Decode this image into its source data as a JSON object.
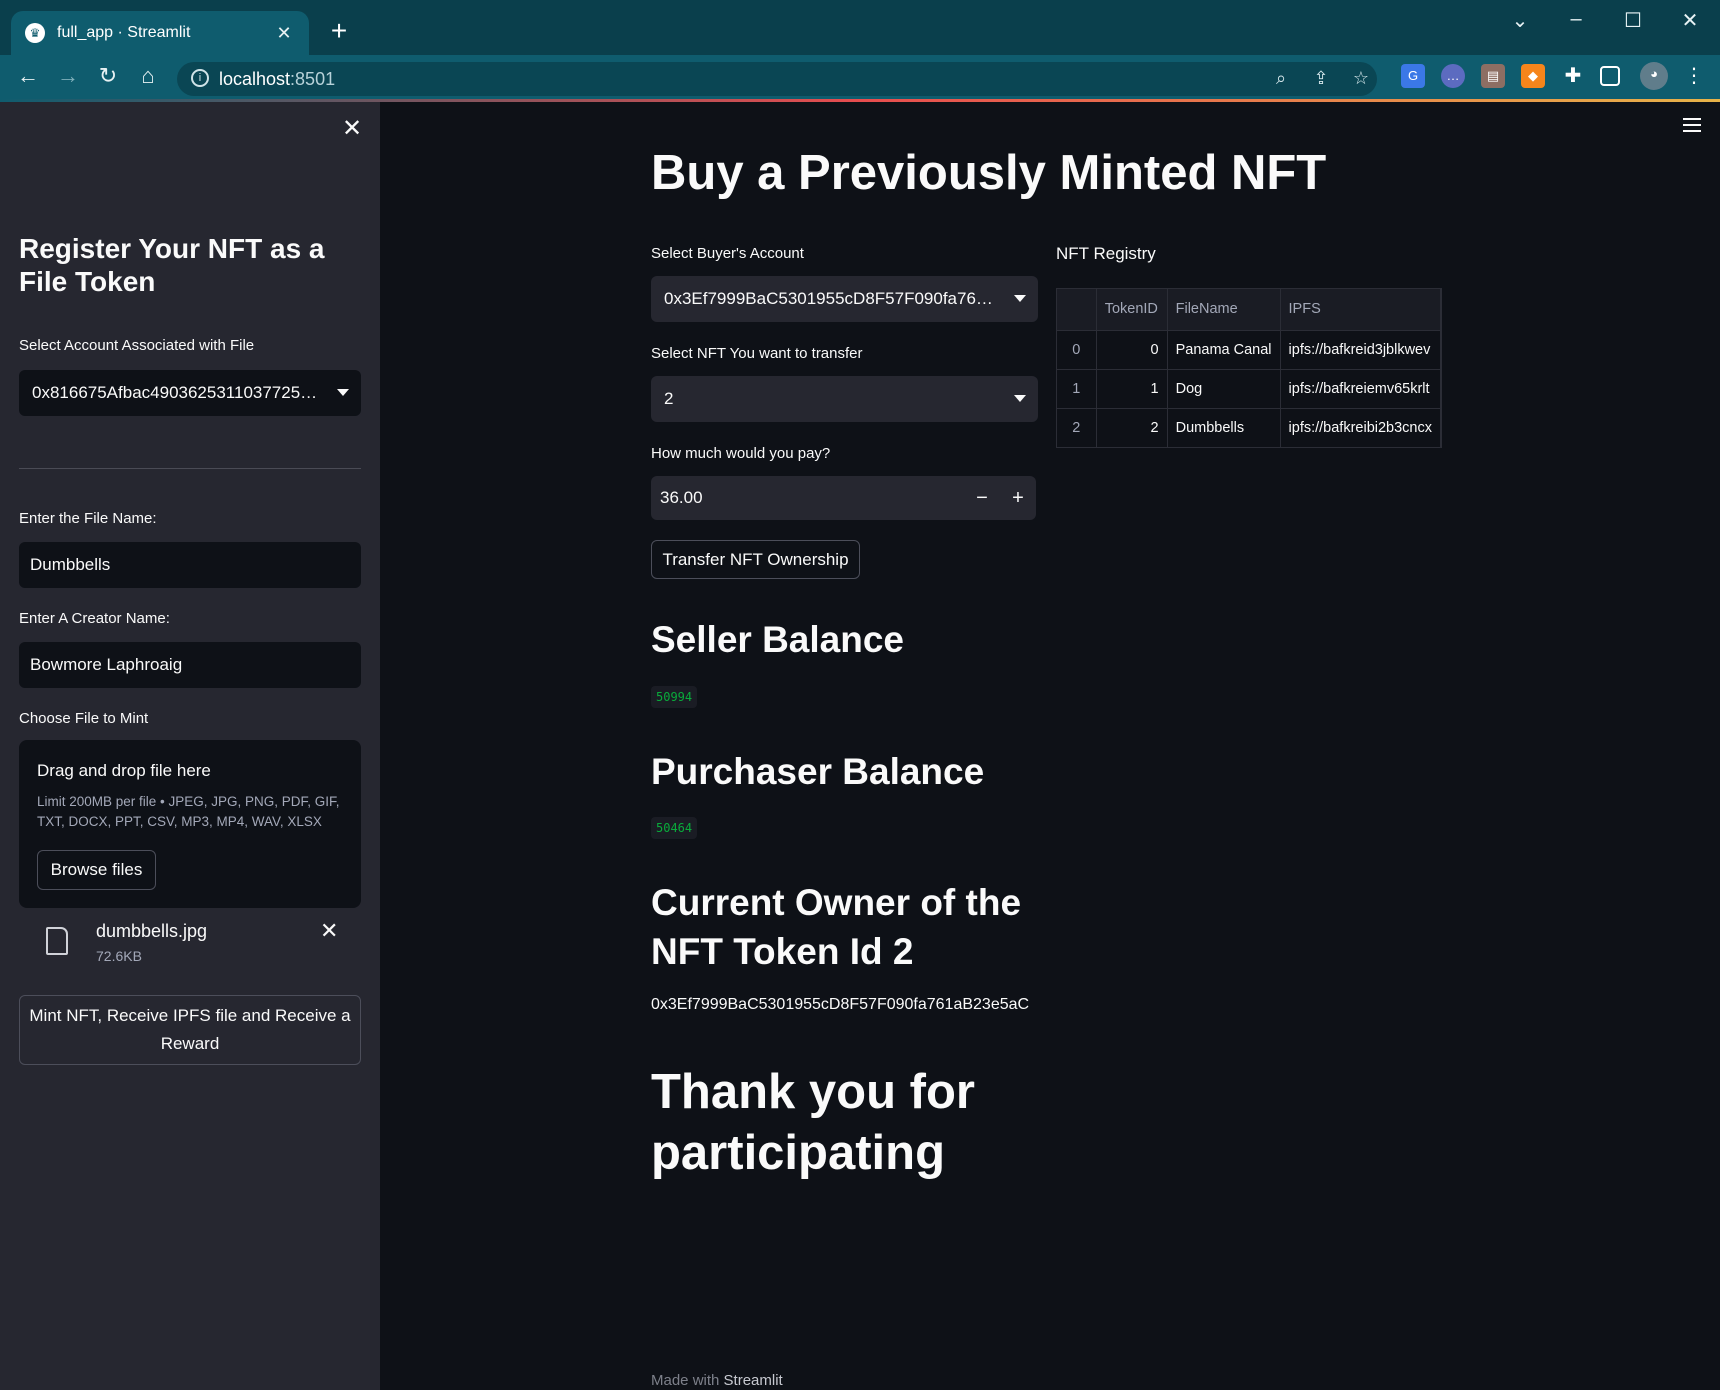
{
  "browser": {
    "tab_title": "full_app · Streamlit",
    "url_host": "localhost",
    "url_port": ":8501"
  },
  "sidebar": {
    "title": "Register Your NFT as a File Token",
    "account_label": "Select Account Associated with File",
    "account_value": "0x816675Afbac49036253110377255…",
    "file_name_label": "Enter the File Name:",
    "file_name_value": "Dumbbells",
    "creator_label": "Enter A Creator Name:",
    "creator_value": "Bowmore Laphroaig",
    "choose_file_label": "Choose File to Mint",
    "dropzone_title": "Drag and drop file here",
    "dropzone_limit": "Limit 200MB per file • JPEG, JPG, PNG, PDF, GIF, TXT, DOCX, PPT, CSV, MP3, MP4, WAV, XLSX",
    "browse_label": "Browse files",
    "uploaded_file_name": "dumbbells.jpg",
    "uploaded_file_size": "72.6KB",
    "mint_button_label": "Mint NFT, Receive IPFS file and Receive a Reward"
  },
  "main": {
    "title": "Buy a Previously Minted NFT",
    "buyer_label": "Select Buyer's Account",
    "buyer_value": "0x3Ef7999BaC5301955cD8F57F090fa761a…",
    "nft_label": "Select NFT You want to transfer",
    "nft_value": "2",
    "pay_label": "How much would you pay?",
    "pay_value": "36.00",
    "transfer_button_label": "Transfer NFT Ownership",
    "seller_heading": "Seller Balance",
    "seller_balance": "50994",
    "purchaser_heading": "Purchaser Balance",
    "purchaser_balance": "50464",
    "owner_heading": "Current Owner of the NFT Token Id 2",
    "owner_address": "0x3Ef7999BaC5301955cD8F57F090fa761aB23e5aC",
    "thanks_heading": "Thank you for participating",
    "footer_prefix": "Made with ",
    "footer_brand": "Streamlit"
  },
  "registry": {
    "title": "NFT Registry",
    "columns": [
      "",
      "TokenID",
      "FileName",
      "IPFS"
    ],
    "rows": [
      [
        "0",
        "0",
        "Panama Canal",
        "ipfs://bafkreid3jblkwev"
      ],
      [
        "1",
        "1",
        "Dog",
        "ipfs://bafkreiemv65krlt"
      ],
      [
        "2",
        "2",
        "Dumbbells",
        "ipfs://bafkreibi2b3cncx"
      ]
    ]
  },
  "colors": {
    "app_background": "#0e1117",
    "sidebar_background": "#262730",
    "browser_frame": "#0f5c6e",
    "code_green": "#09ab3b"
  },
  "icons": [
    "streamlit-favicon",
    "close-icon",
    "plus-icon",
    "back-icon",
    "forward-icon",
    "reload-icon",
    "home-icon",
    "info-icon",
    "zoom-icon",
    "share-icon",
    "star-icon",
    "menu-icon",
    "file-icon",
    "caret-down-icon"
  ]
}
